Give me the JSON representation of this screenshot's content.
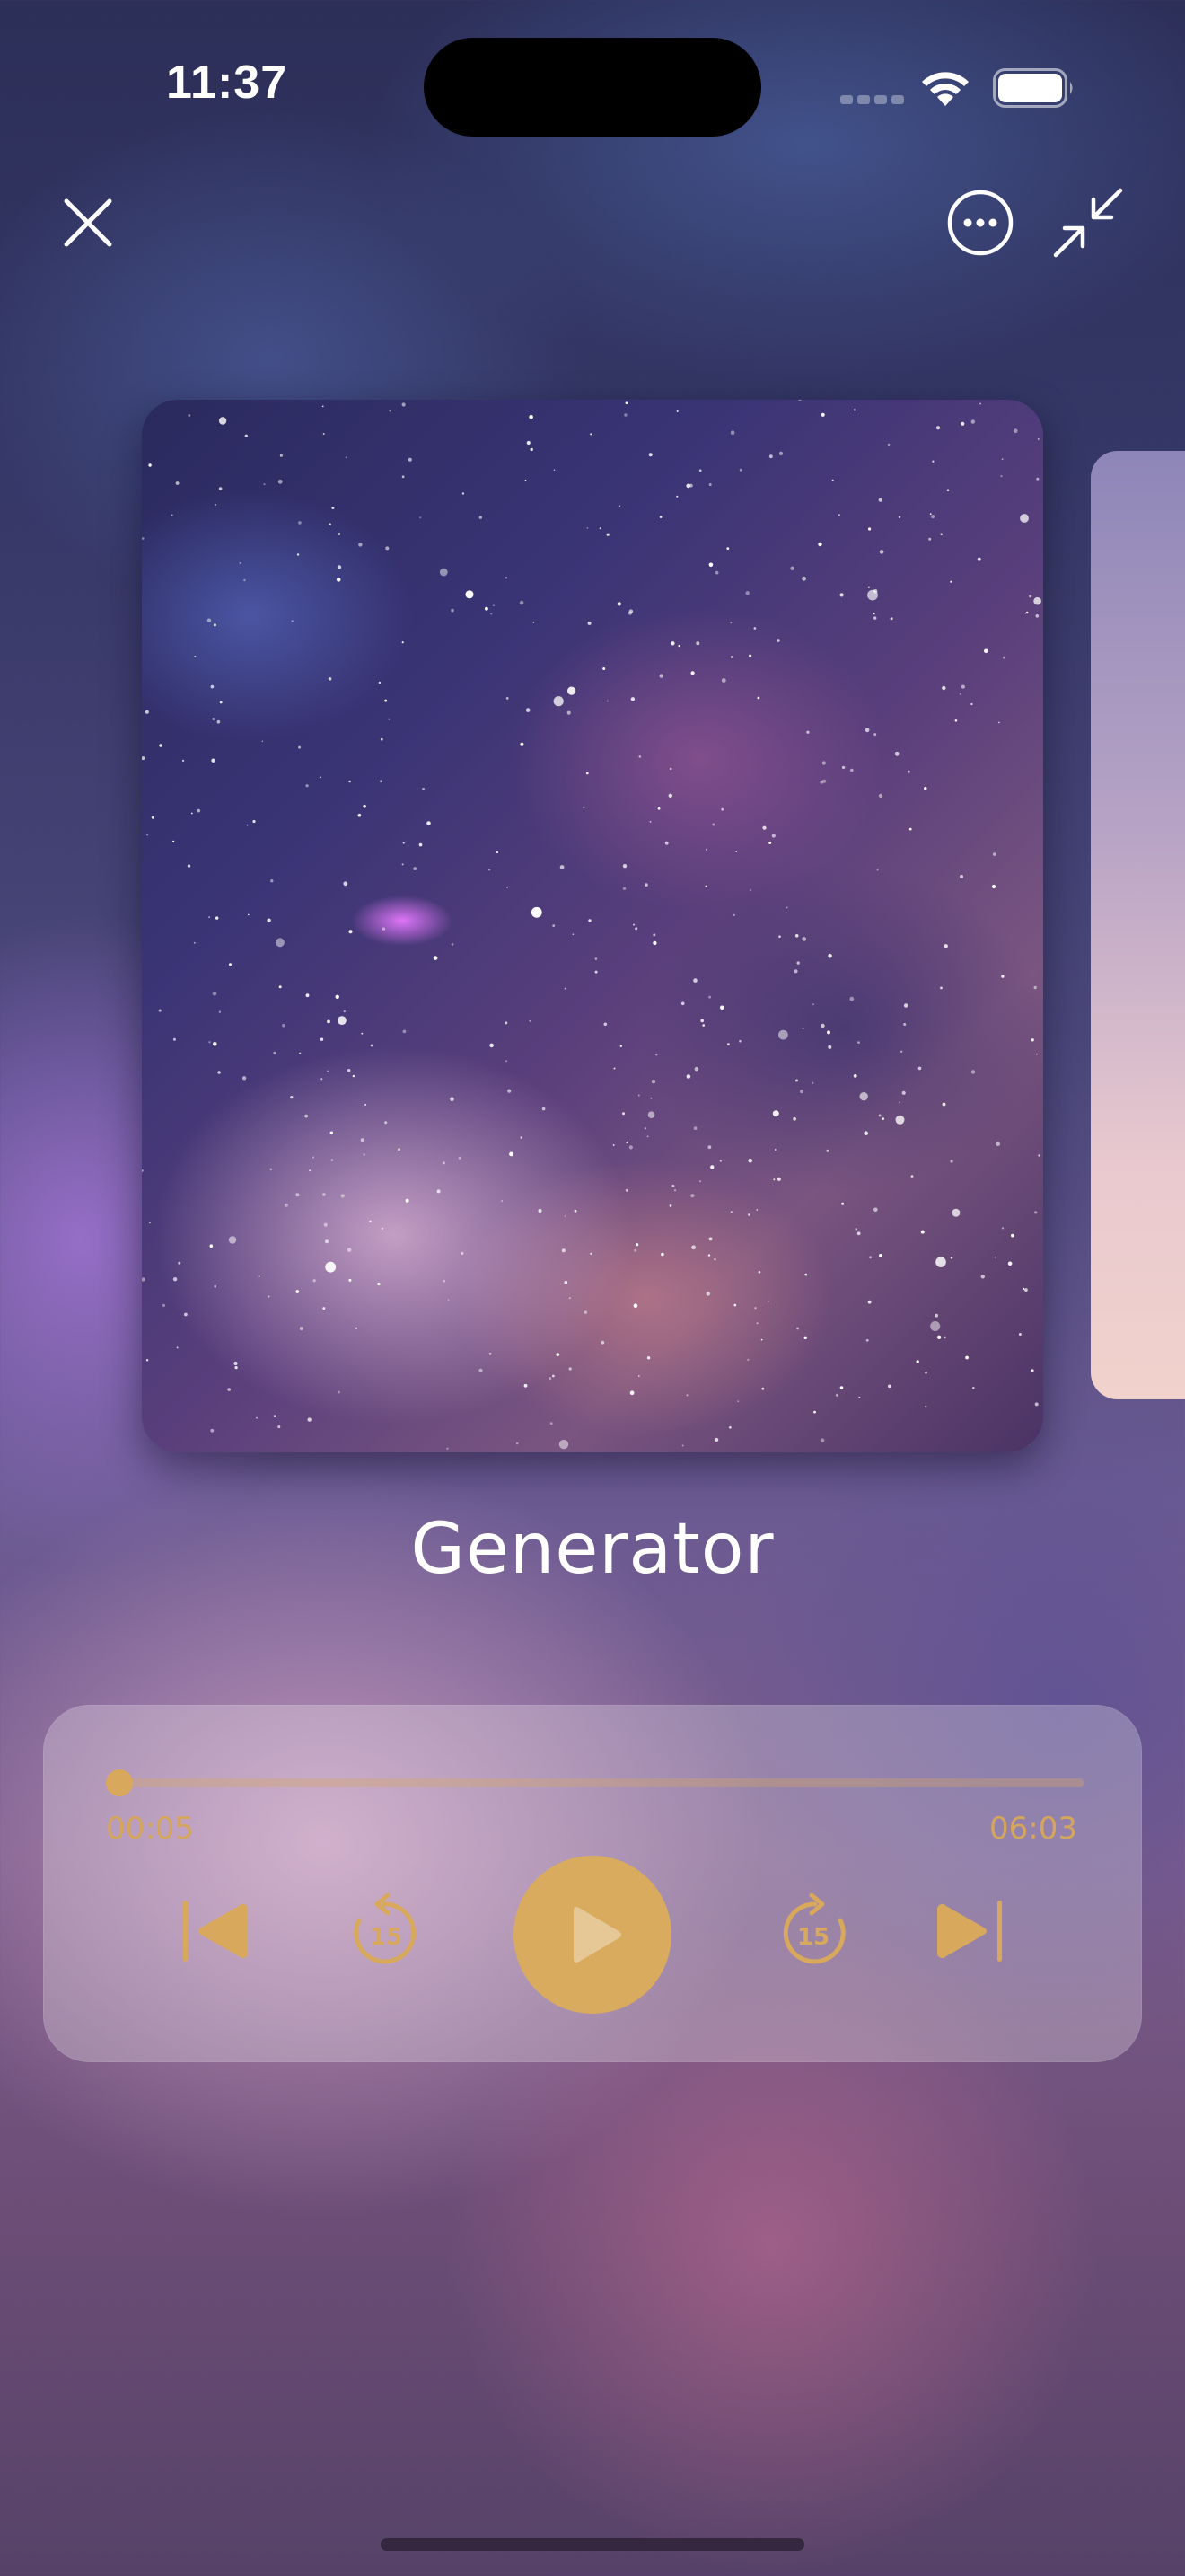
{
  "status_bar": {
    "time": "11:37",
    "icons": [
      "cellular-signal-icon",
      "wifi-icon",
      "battery-icon"
    ]
  },
  "top_bar": {
    "icons": [
      "close-icon",
      "more-options-icon",
      "minimize-icon"
    ]
  },
  "track": {
    "title": "Generator",
    "artwork": "starry-night-sky-milky-way"
  },
  "player": {
    "elapsed": "00:05",
    "total": "06:03",
    "progress_fraction": 0.014,
    "controls": [
      "skip-previous-icon",
      "rewind-15-icon",
      "play-icon",
      "forward-15-icon",
      "skip-next-icon"
    ],
    "skip_seconds": "15"
  },
  "colors": {
    "accent": "#D8A85C",
    "text": "#FFFFFF"
  }
}
